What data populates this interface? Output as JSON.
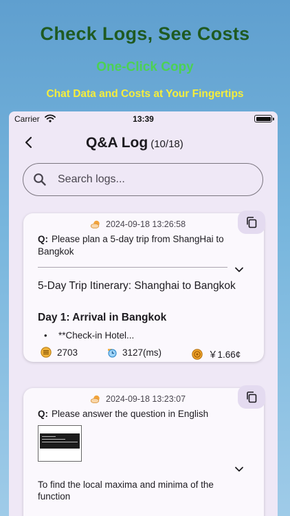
{
  "promo": {
    "title": "Check Logs, See Costs",
    "subtitle": "One-Click Copy",
    "tagline": "Chat Data and Costs at Your Fingertips"
  },
  "status_bar": {
    "carrier": "Carrier",
    "time": "13:39"
  },
  "nav": {
    "title": "Q&A Log",
    "count": "(10/18)"
  },
  "search": {
    "placeholder": "Search logs..."
  },
  "logs": [
    {
      "timestamp": "2024-09-18 13:26:58",
      "question_prefix": "Q:",
      "question": "Please plan a 5-day trip from ShangHai to Bangkok",
      "answer_title": "5-Day Trip Itinerary: Shanghai to Bangkok",
      "answer_heading": "Day 1: Arrival in Bangkok",
      "bullet": "**Check-in Hotel...",
      "tokens": "2703",
      "duration": "3127(ms)",
      "cost": "￥1.66¢"
    },
    {
      "timestamp": "2024-09-18 13:23:07",
      "question_prefix": "Q:",
      "question": "Please answer the question in English",
      "answer": "To find the local maxima and minima of the function"
    }
  ],
  "colors": {
    "promo_title": "#1f5a22",
    "promo_subtitle": "#4cd154",
    "promo_tagline": "#f6ee3b",
    "screen_bg": "#efe8f6",
    "card_bg": "#fbf8fd",
    "copy_button_bg": "#e4dbf0"
  },
  "icons": {
    "wifi": "wifi-icon",
    "battery": "battery-icon",
    "back": "chevron-left-icon",
    "search": "search-icon",
    "copy": "copy-icon",
    "time": "cloud-sun-icon",
    "expand": "chevron-down-icon",
    "tokens": "coin-stack-icon",
    "duration": "timer-icon",
    "cost": "coin-icon"
  }
}
